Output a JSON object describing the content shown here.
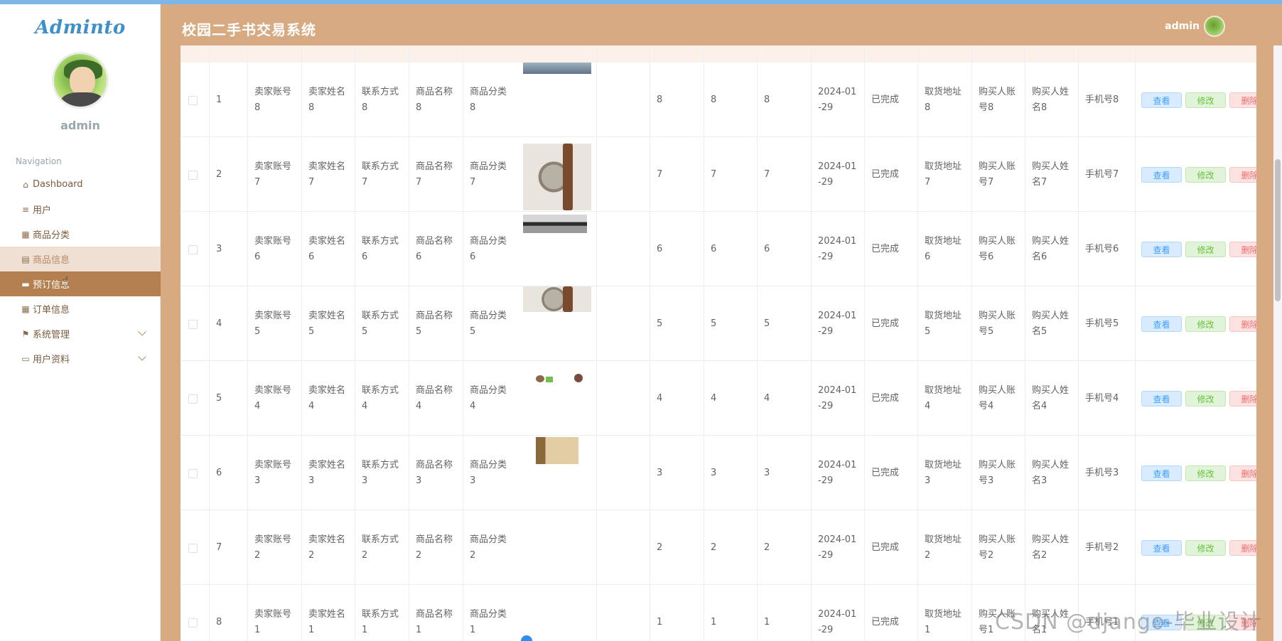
{
  "app": {
    "logo": "Adminto",
    "title": "校园二手书交易系统",
    "admin_name": "admin"
  },
  "sidebar": {
    "user_name": "admin",
    "nav_title": "Navigation",
    "items": [
      {
        "label": "Dashboard",
        "icon": "home-icon",
        "state": "normal",
        "has_chevron": false
      },
      {
        "label": "用户",
        "icon": "menu-icon",
        "state": "normal",
        "has_chevron": false
      },
      {
        "label": "商品分类",
        "icon": "grid-icon",
        "state": "normal",
        "has_chevron": false
      },
      {
        "label": "商品信息",
        "icon": "chart-icon",
        "state": "hover",
        "has_chevron": false
      },
      {
        "label": "预订信息",
        "icon": "monitor-icon",
        "state": "active",
        "has_chevron": false
      },
      {
        "label": "订单信息",
        "icon": "grid-icon",
        "state": "normal",
        "has_chevron": false
      },
      {
        "label": "系统管理",
        "icon": "flag-icon",
        "state": "normal",
        "has_chevron": true
      },
      {
        "label": "用户资料",
        "icon": "card-icon",
        "state": "normal",
        "has_chevron": true
      }
    ]
  },
  "table": {
    "actions": {
      "view": "查看",
      "edit": "修改",
      "delete": "删除"
    },
    "rows": [
      {
        "index": "1",
        "seller_account": "卖家账号8",
        "seller_name": "卖家姓名8",
        "contact": "联系方式8",
        "product_name": "商品名称8",
        "category": "商品分类8",
        "image": "road",
        "n1": "8",
        "n2": "8",
        "n3": "8",
        "date": "2024-01-29",
        "status": "已完成",
        "pickup": "取货地址8",
        "buyer_account": "购买人账号8",
        "buyer_name": "购买人姓名8",
        "phone": "手机号8"
      },
      {
        "index": "2",
        "seller_account": "卖家账号7",
        "seller_name": "卖家姓名7",
        "contact": "联系方式7",
        "product_name": "商品名称7",
        "category": "商品分类7",
        "image": "watch",
        "n1": "7",
        "n2": "7",
        "n3": "7",
        "date": "2024-01-29",
        "status": "已完成",
        "pickup": "取货地址7",
        "buyer_account": "购买人账号7",
        "buyer_name": "购买人姓名7",
        "phone": "手机号7"
      },
      {
        "index": "3",
        "seller_account": "卖家账号6",
        "seller_name": "卖家姓名6",
        "contact": "联系方式6",
        "product_name": "商品名称6",
        "category": "商品分类6",
        "image": "device",
        "n1": "6",
        "n2": "6",
        "n3": "6",
        "date": "2024-01-29",
        "status": "已完成",
        "pickup": "取货地址6",
        "buyer_account": "购买人账号6",
        "buyer_name": "购买人姓名6",
        "phone": "手机号6"
      },
      {
        "index": "4",
        "seller_account": "卖家账号5",
        "seller_name": "卖家姓名5",
        "contact": "联系方式5",
        "product_name": "商品名称5",
        "category": "商品分类5",
        "image": "watch-crop",
        "n1": "5",
        "n2": "5",
        "n3": "5",
        "date": "2024-01-29",
        "status": "已完成",
        "pickup": "取货地址5",
        "buyer_account": "购买人账号5",
        "buyer_name": "购买人姓名5",
        "phone": "手机号5"
      },
      {
        "index": "5",
        "seller_account": "卖家账号4",
        "seller_name": "卖家姓名4",
        "contact": "联系方式4",
        "product_name": "商品名称4",
        "category": "商品分类4",
        "image": "people",
        "n1": "4",
        "n2": "4",
        "n3": "4",
        "date": "2024-01-29",
        "status": "已完成",
        "pickup": "取货地址4",
        "buyer_account": "购买人账号4",
        "buyer_name": "购买人姓名4",
        "phone": "手机号4"
      },
      {
        "index": "6",
        "seller_account": "卖家账号3",
        "seller_name": "卖家姓名3",
        "contact": "联系方式3",
        "product_name": "商品名称3",
        "category": "商品分类3",
        "image": "card",
        "n1": "3",
        "n2": "3",
        "n3": "3",
        "date": "2024-01-29",
        "status": "已完成",
        "pickup": "取货地址3",
        "buyer_account": "购买人账号3",
        "buyer_name": "购买人姓名3",
        "phone": "手机号3"
      },
      {
        "index": "7",
        "seller_account": "卖家账号2",
        "seller_name": "卖家姓名2",
        "contact": "联系方式2",
        "product_name": "商品名称2",
        "category": "商品分类2",
        "image": "none",
        "n1": "2",
        "n2": "2",
        "n3": "2",
        "date": "2024-01-29",
        "status": "已完成",
        "pickup": "取货地址2",
        "buyer_account": "购买人账号2",
        "buyer_name": "购买人姓名2",
        "phone": "手机号2"
      },
      {
        "index": "8",
        "seller_account": "卖家账号1",
        "seller_name": "卖家姓名1",
        "contact": "联系方式1",
        "product_name": "商品名称1",
        "category": "商品分类1",
        "image": "none",
        "n1": "1",
        "n2": "1",
        "n3": "1",
        "date": "2024-01-29",
        "status": "已完成",
        "pickup": "取货地址1",
        "buyer_account": "购买人账号1",
        "buyer_name": "购买人姓名1",
        "phone": "手机号1"
      }
    ]
  },
  "watermark": "CSDN @django-毕业设计",
  "colors": {
    "header_bg": "#d7aa82",
    "active_nav": "#b5804f",
    "hover_nav": "#f0e0d3",
    "view_btn": "#409eff",
    "edit_btn": "#67c23a",
    "delete_btn": "#f56c6c"
  }
}
